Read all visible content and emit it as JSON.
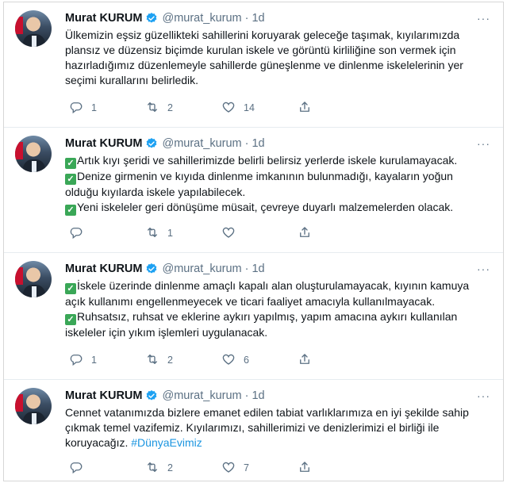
{
  "tweets": [
    {
      "name": "Murat KURUM",
      "handle": "@murat_kurum",
      "time": "1d",
      "more": "···",
      "lines": [
        {
          "check": false,
          "text": "Ülkemizin eşsiz güzellikteki sahillerini koruyarak geleceğe taşımak, kıyılarımızda"
        },
        {
          "check": false,
          "text": "plansız ve düzensiz biçimde kurulan iskele ve görüntü kirliliğine son vermek için"
        },
        {
          "check": false,
          "text": "hazırladığımız düzenlemeyle sahillerde güneşlenme ve dinlenme iskelelerinin yer"
        },
        {
          "check": false,
          "text": "seçimi kurallarını belirledik."
        }
      ],
      "replies": "1",
      "retweets": "2",
      "likes": "14"
    },
    {
      "name": "Murat KURUM",
      "handle": "@murat_kurum",
      "time": "1d",
      "more": "···",
      "lines": [
        {
          "check": true,
          "text": "Artık kıyı şeridi ve sahillerimizde belirli belirsiz yerlerde iskele kurulamayacak."
        },
        {
          "check": true,
          "text": "Denize girmenin ve kıyıda dinlenme imkanının bulunmadığı, kayaların yoğun"
        },
        {
          "check": false,
          "text": "olduğu kıyılarda iskele yapılabilecek."
        },
        {
          "check": true,
          "text": "Yeni iskeleler geri dönüşüme müsait, çevreye duyarlı malzemelerden olacak."
        }
      ],
      "replies": "",
      "retweets": "1",
      "likes": ""
    },
    {
      "name": "Murat KURUM",
      "handle": "@murat_kurum",
      "time": "1d",
      "more": "···",
      "lines": [
        {
          "check": true,
          "text": "İskele üzerinde dinlenme amaçlı kapalı alan oluşturulamayacak, kıyının kamuya"
        },
        {
          "check": false,
          "text": "açık kullanımı engellenmeyecek ve ticari faaliyet amacıyla kullanılmayacak."
        },
        {
          "check": true,
          "text": "Ruhsatsız, ruhsat ve eklerine aykırı yapılmış, yapım amacına aykırı kullanılan"
        },
        {
          "check": false,
          "text": "iskeleler için yıkım işlemleri uygulanacak."
        }
      ],
      "replies": "1",
      "retweets": "2",
      "likes": "6"
    },
    {
      "name": "Murat KURUM",
      "handle": "@murat_kurum",
      "time": "1d",
      "more": "···",
      "lines": [
        {
          "check": false,
          "text": "Cennet vatanımızda bizlere emanet edilen tabiat varlıklarımıza en iyi şekilde sahip"
        },
        {
          "check": false,
          "text": "çıkmak temel vazifemiz. Kıyılarımızı, sahillerimizi ve denizlerimizi el birliği ile"
        },
        {
          "check": false,
          "text": "koruyacağız.",
          "hashtag": "#DünyaEvimiz"
        }
      ],
      "replies": "",
      "retweets": "2",
      "likes": "7"
    }
  ],
  "colors": {
    "text": "#0f1419",
    "secondary": "#5b7083",
    "verified": "#1da1f2",
    "check": "#3aa757",
    "hashtag": "#1b95e0"
  }
}
